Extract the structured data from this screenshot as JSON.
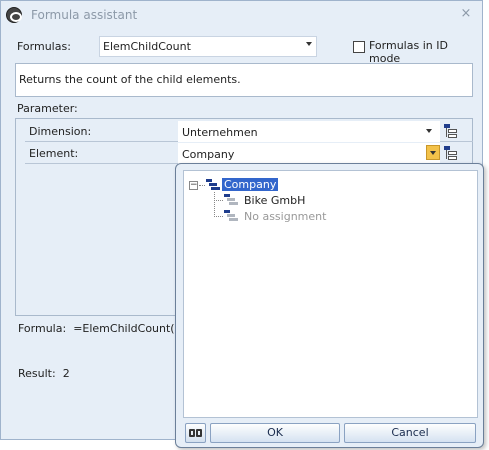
{
  "window": {
    "title": "Formula assistant",
    "close_glyph": "×"
  },
  "formulas": {
    "label": "Formulas:",
    "selected": "ElemChildCount",
    "id_mode_label": "Formulas in ID mode",
    "id_mode_checked": false
  },
  "description": "Returns the count of the child elements.",
  "parameters": {
    "label": "Parameter:",
    "rows": [
      {
        "name": "Dimension:",
        "value": "Unternehmen"
      },
      {
        "name": "Element:",
        "value": "Company"
      }
    ]
  },
  "formula": {
    "label": "Formula:",
    "expression": "=ElemChildCount(\"Un"
  },
  "result": {
    "label": "Result:",
    "value": "2"
  },
  "popup": {
    "tree": {
      "root": {
        "label": "Company",
        "expander": "−"
      },
      "children": [
        {
          "label": "Bike GmbH"
        },
        {
          "label": "No assignment"
        }
      ]
    },
    "ok_label": "OK",
    "cancel_label": "Cancel"
  },
  "colors": {
    "window_bg": "#e6eef7",
    "selection": "#3366cc",
    "hierarchy_icon": "#1e3c8c",
    "active_dropdown": "#f3c24a"
  }
}
